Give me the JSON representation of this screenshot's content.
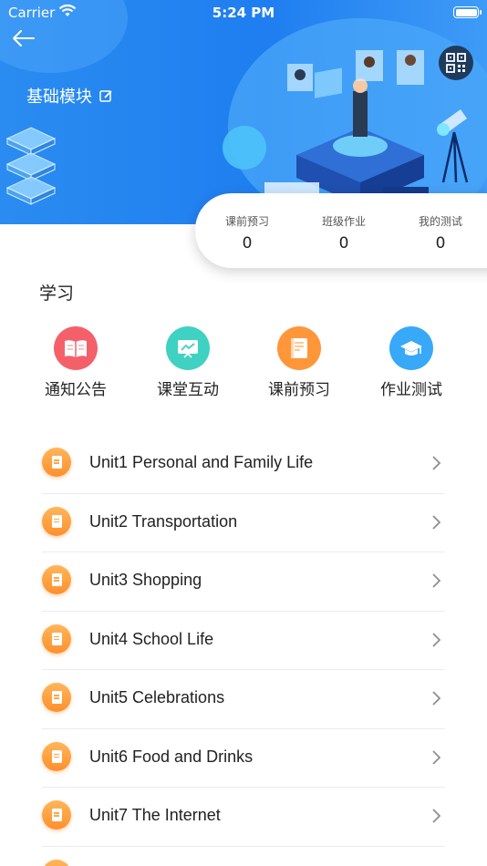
{
  "status_bar": {
    "carrier": "Carrier",
    "time": "5:24 PM"
  },
  "header": {
    "title": "基础模块"
  },
  "stats": [
    {
      "label": "课前预习",
      "value": "0"
    },
    {
      "label": "班级作业",
      "value": "0"
    },
    {
      "label": "我的测试",
      "value": "0"
    }
  ],
  "study": {
    "section_title": "学习",
    "items": [
      {
        "label": "通知公告",
        "icon": "book-icon",
        "color": "#f4606a"
      },
      {
        "label": "课堂互动",
        "icon": "board-icon",
        "color": "#3fd1c1"
      },
      {
        "label": "课前预习",
        "icon": "notebook-icon",
        "color": "#ff963a"
      },
      {
        "label": "作业测试",
        "icon": "graduation-cap-icon",
        "color": "#38a8f8"
      }
    ]
  },
  "units": [
    {
      "label": "Unit1 Personal and Family Life"
    },
    {
      "label": "Unit2 Transportation"
    },
    {
      "label": "Unit3 Shopping"
    },
    {
      "label": "Unit4 School Life"
    },
    {
      "label": "Unit5 Celebrations"
    },
    {
      "label": "Unit6 Food and Drinks"
    },
    {
      "label": "Unit7 The Internet"
    }
  ]
}
